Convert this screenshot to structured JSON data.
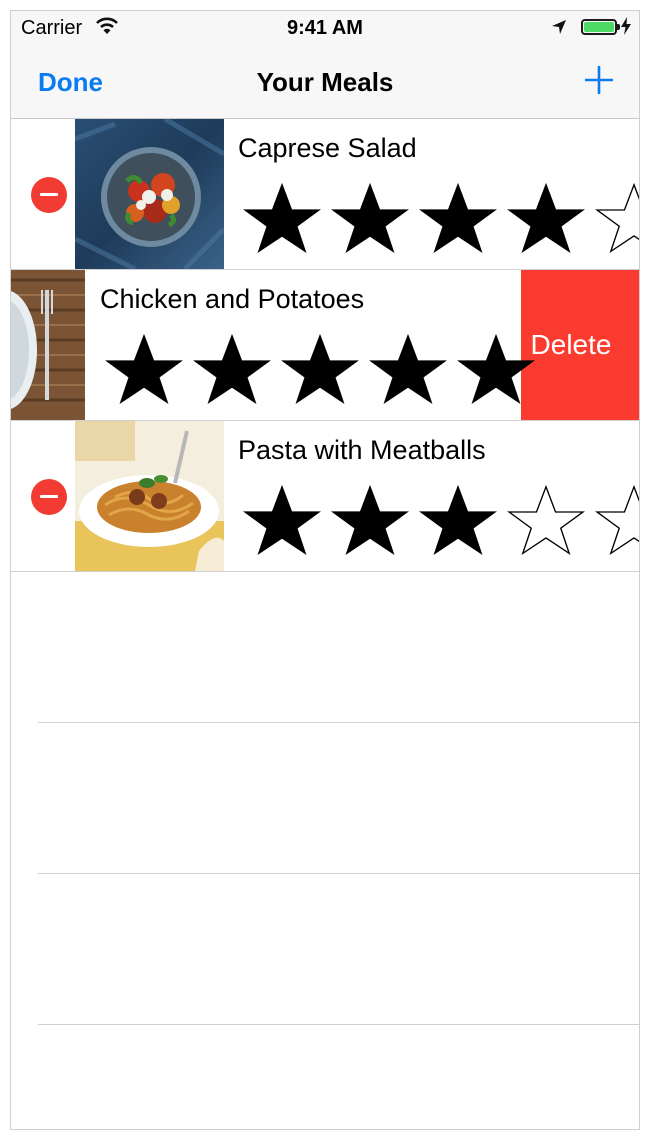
{
  "status_bar": {
    "carrier": "Carrier",
    "time": "9:41 AM",
    "battery_color": "#4cd964"
  },
  "nav": {
    "done_label": "Done",
    "title": "Your Meals",
    "add_icon": "plus-icon",
    "accent": "#0a7cf2"
  },
  "meals": [
    {
      "name": "Caprese Salad",
      "rating": 4,
      "max_rating": 5
    },
    {
      "name": "Chicken and Potatoes",
      "rating": 5,
      "max_rating": 5
    },
    {
      "name": "Pasta with Meatballs",
      "rating": 3,
      "max_rating": 5
    }
  ],
  "actions": {
    "delete_label": "Delete",
    "delete_color": "#fb3b30",
    "remove_icon_color": "#f23c33"
  }
}
